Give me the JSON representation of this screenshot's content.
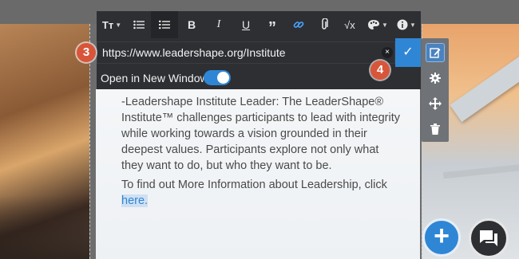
{
  "toolbar": {
    "items": [
      {
        "name": "text-size",
        "glyph": "Tᴛ",
        "caret": true
      },
      {
        "name": "bulleted-list",
        "glyph": "☰"
      },
      {
        "name": "numbered-list",
        "glyph": "≡",
        "active": true
      },
      {
        "name": "bold",
        "glyph": "B"
      },
      {
        "name": "italic",
        "glyph": "I"
      },
      {
        "name": "underline",
        "glyph": "U"
      },
      {
        "name": "quote",
        "glyph": "”"
      },
      {
        "name": "link",
        "glyph": "⚭",
        "active_color": "#4aa3ff"
      },
      {
        "name": "attachment",
        "glyph": "⎘"
      },
      {
        "name": "formula",
        "glyph": "√x"
      },
      {
        "name": "color",
        "glyph": "☼",
        "caret": true
      },
      {
        "name": "info",
        "glyph": "ⓘ",
        "caret": true
      }
    ]
  },
  "link_editor": {
    "url": "https://www.leadershape.org/Institute",
    "clear_glyph": "×",
    "confirm_glyph": "✓",
    "open_new_window_label": "Open in New Window",
    "open_new_window": true
  },
  "content": {
    "paragraph1": "-Leadershape Institute Leader: The LeaderShape® Institute™ challenges participants to lead with integrity while working towards a vision grounded in their deepest values. Participants explore not only what they want to do, but who they want to be.",
    "paragraph2_text": "To find out More Information about Leadership, click ",
    "paragraph2_link": "here."
  },
  "side_tools": [
    "edit-icon",
    "settings-icon",
    "move-icon",
    "delete-icon"
  ],
  "badges": {
    "step3": "3",
    "step4": "4"
  },
  "colors": {
    "accent": "#2f86d5",
    "toolbar": "#2d2f33",
    "badge": "#d9553a"
  }
}
